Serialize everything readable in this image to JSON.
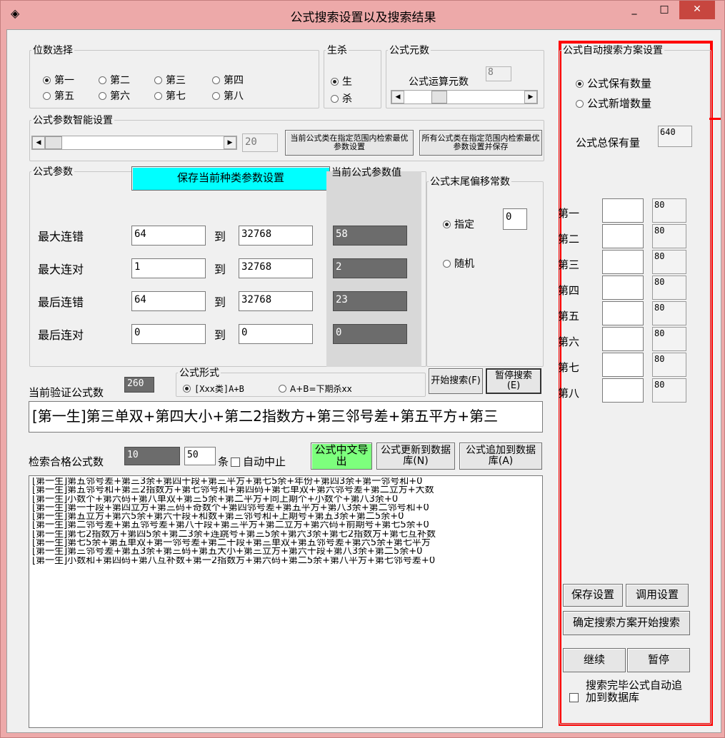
{
  "window": {
    "title": "公式搜索设置以及搜索结果",
    "app_icon": "binoculars-icon",
    "min_glyph": "_",
    "max_glyph": "□",
    "close_glyph": "✕"
  },
  "digit_group": {
    "label": "位数选择",
    "options": [
      "第一",
      "第二",
      "第三",
      "第四",
      "第五",
      "第六",
      "第七",
      "第八"
    ],
    "selected": "第一"
  },
  "kill_group": {
    "label": "生杀",
    "options": [
      "生",
      "杀"
    ],
    "selected": "生"
  },
  "elements_group": {
    "label": "公式元数",
    "count_label": "公式运算元数",
    "count_value": "8"
  },
  "smart_group": {
    "label": "公式参数智能设置",
    "value": "20",
    "btn_current": "当前公式类在指定范围内检索最优参数设置",
    "btn_all": "所有公式类在指定范围内检索最优参数设置并保存"
  },
  "params": {
    "label": "公式参数",
    "save_button": "保存当前种类参数设置",
    "current_label": "当前公式参数值",
    "to": "到",
    "rows": [
      {
        "name": "最大连错",
        "from": "64",
        "to": "32768",
        "current": "58"
      },
      {
        "name": "最大连对",
        "from": "1",
        "to": "32768",
        "current": "2"
      },
      {
        "name": "最后连错",
        "from": "64",
        "to": "32768",
        "current": "23"
      },
      {
        "name": "最后连对",
        "from": "0",
        "to": "0",
        "current": "0"
      }
    ]
  },
  "offset_group": {
    "label": "公式末尾偏移常数",
    "specified": "指定",
    "specified_value": "0",
    "random": "随机",
    "selected": "指定"
  },
  "verify": {
    "label": "当前验证公式数",
    "value": "260"
  },
  "form_group": {
    "label": "公式形式",
    "options": [
      "[Xxx类]A+B",
      "A+B=下期杀xx"
    ],
    "selected": "[Xxx类]A+B"
  },
  "start_button": "开始搜索(F)",
  "pause_search_button": "暂停搜索(E)",
  "formula_line": "[第一生]第三单双+第四大小+第二2指数方+第三邻号差+第五平方+第三",
  "qualified": {
    "label": "检索合格公式数",
    "value": "10",
    "limit": "50",
    "unit": "条",
    "auto_stop": "自动中止",
    "export_cn": "公式中文导出",
    "update_db": "公式更新到数据库(N)",
    "append_db": "公式追加到数据库(A)"
  },
  "results": [
    "[第一生]第五邻号差+第三3余+第四十段+第三平方+第七5余+年份+第四3余+第一邻号和+0",
    "[第一生]第五邻号和+第三2指数方+第七邻号和+第四码+第七单双+第六邻号差+第二立方+大数",
    "[第一生]小数个+第六码+第八单双+第三5余+第二平方+同上期个+小数个+第八3余+0",
    "[第一生]第一十段+第四立方+第三码+奇数个+第四邻号差+第五平方+第八3余+第二邻号和+0",
    "[第一生]第五立方+第六5余+第六十段+和数+第三邻号和+上期号+第五3余+第二5余+0",
    "[第一生]第二邻号差+第五邻号差+第八十段+第三平方+第二立方+第六码+前期号+第七5余+0",
    "[第一生]第七2指数方+第四5余+第二3余+连跳号+第三5余+第六3余+第七2指数方+第七互补数",
    "[第一生]第七5余+第五单双+第一邻号差+第二十段+第三单双+第五邻号差+第六5余+第七平方",
    "[第一生]第三邻号差+第五3余+第三码+第五大小+第三立方+第六十段+第八3余+第二5余+0",
    "[第一生]小数和+第四码+第八互补数+第一2指数方+第六码+第二5余+第八平方+第七邻号差+0"
  ],
  "auto_panel": {
    "label": "公式自动搜索方案设置",
    "opt_keep": "公式保有数量",
    "opt_new": "公式新增数量",
    "selected": "公式保有数量",
    "total_label": "公式总保有量",
    "total_value": "640",
    "rows": [
      {
        "name": "第一",
        "value": "",
        "count": "80"
      },
      {
        "name": "第二",
        "value": "",
        "count": "80"
      },
      {
        "name": "第三",
        "value": "",
        "count": "80"
      },
      {
        "name": "第四",
        "value": "",
        "count": "80"
      },
      {
        "name": "第五",
        "value": "",
        "count": "80"
      },
      {
        "name": "第六",
        "value": "",
        "count": "80"
      },
      {
        "name": "第七",
        "value": "",
        "count": "80"
      },
      {
        "name": "第八",
        "value": "",
        "count": "80"
      }
    ],
    "save_settings": "保存设置",
    "load_settings": "调用设置",
    "confirm_start": "确定搜索方案开始搜索",
    "continue": "继续",
    "pause": "暂停",
    "auto_append": "搜索完毕公式自动追加到数据库"
  },
  "colors": {
    "highlight": "#ff0000",
    "save_btn": "#00ffff",
    "export_btn": "#7dff7d",
    "current_value_bg": "#6c6c6c"
  }
}
